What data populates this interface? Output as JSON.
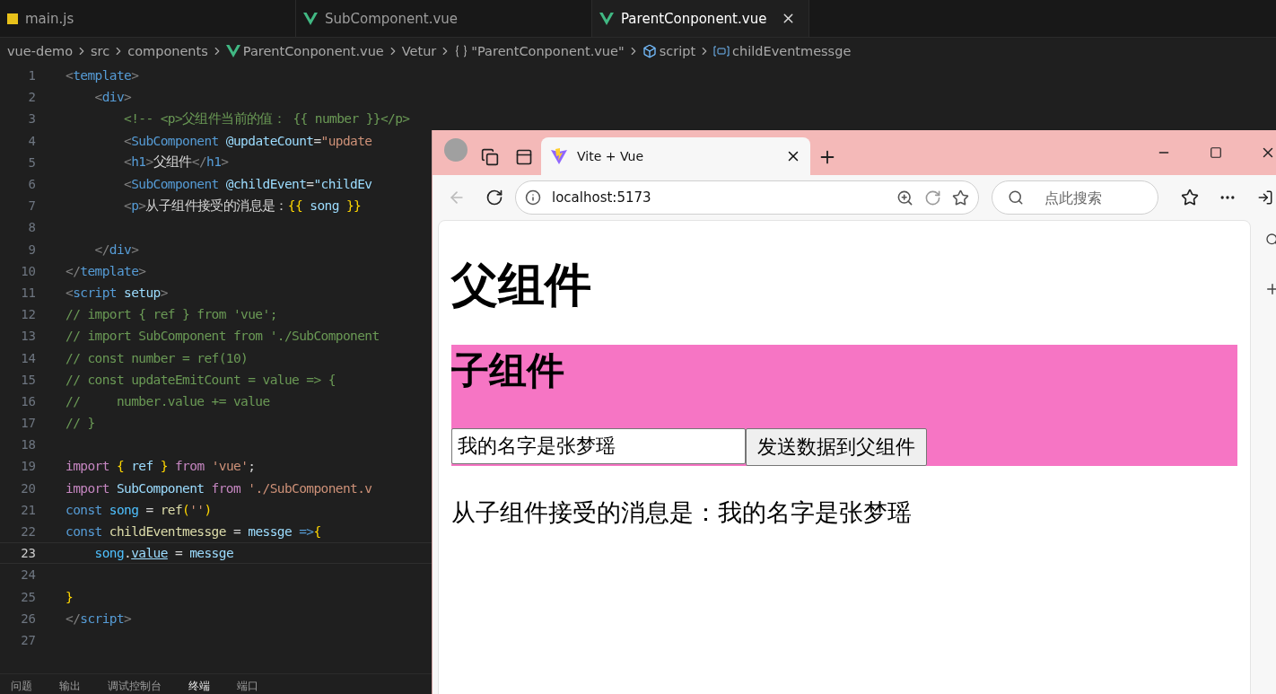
{
  "editor": {
    "tabs": [
      {
        "label": "main.js",
        "kind": "js",
        "selected": false
      },
      {
        "label": "SubComponent.vue",
        "kind": "vue",
        "selected": false
      },
      {
        "label": "ParentConponent.vue",
        "kind": "vue",
        "selected": true
      }
    ],
    "breadcrumbs": [
      {
        "label": "vue-demo",
        "kind": "text"
      },
      {
        "label": "src",
        "kind": "text"
      },
      {
        "label": "components",
        "kind": "text"
      },
      {
        "label": "ParentConponent.vue",
        "kind": "vue"
      },
      {
        "label": "Vetur",
        "kind": "text"
      },
      {
        "label": "\"ParentConponent.vue\"",
        "kind": "object"
      },
      {
        "label": "script",
        "kind": "cube"
      },
      {
        "label": "childEventmessge",
        "kind": "variable"
      }
    ],
    "lines": [
      {
        "number": "1",
        "current": false,
        "tokens": [
          {
            "text": "<",
            "kind": "punct"
          },
          {
            "text": "template",
            "kind": "tag"
          },
          {
            "text": ">",
            "kind": "punct"
          }
        ]
      },
      {
        "number": "2",
        "current": false,
        "tokens": [
          {
            "text": "    <",
            "kind": "punct"
          },
          {
            "text": "div",
            "kind": "tag"
          },
          {
            "text": ">",
            "kind": "punct"
          }
        ]
      },
      {
        "number": "3",
        "current": false,
        "tokens": [
          {
            "text": "        <!-- <p>父组件当前的值： {{ number }}</p>",
            "kind": "comment"
          }
        ]
      },
      {
        "number": "4",
        "current": false,
        "tokens": [
          {
            "text": "        <",
            "kind": "punct"
          },
          {
            "text": "SubComponent",
            "kind": "tag"
          },
          {
            "text": " @updateCount",
            "kind": "attr"
          },
          {
            "text": "=",
            "kind": "text"
          },
          {
            "text": "\"update",
            "kind": "string"
          }
        ]
      },
      {
        "number": "5",
        "current": false,
        "tokens": [
          {
            "text": "        <",
            "kind": "punct"
          },
          {
            "text": "h1",
            "kind": "tag"
          },
          {
            "text": ">",
            "kind": "punct"
          },
          {
            "text": "父组件",
            "kind": "text"
          },
          {
            "text": "</",
            "kind": "punct"
          },
          {
            "text": "h1",
            "kind": "tag"
          },
          {
            "text": ">",
            "kind": "punct"
          }
        ]
      },
      {
        "number": "6",
        "current": false,
        "tokens": [
          {
            "text": "        <",
            "kind": "punct"
          },
          {
            "text": "SubComponent",
            "kind": "tag"
          },
          {
            "text": " @childEvent",
            "kind": "attr"
          },
          {
            "text": "=",
            "kind": "text"
          },
          {
            "text": "\"childEv",
            "kind": "attr"
          }
        ]
      },
      {
        "number": "7",
        "current": false,
        "tokens": [
          {
            "text": "        <",
            "kind": "punct"
          },
          {
            "text": "p",
            "kind": "tag"
          },
          {
            "text": ">",
            "kind": "punct"
          },
          {
            "text": "从子组件接受的消息是：",
            "kind": "text"
          },
          {
            "text": "{{",
            "kind": "brace"
          },
          {
            "text": " song ",
            "kind": "attr"
          },
          {
            "text": "}}",
            "kind": "brace"
          }
        ]
      },
      {
        "number": "8",
        "current": false
      },
      {
        "number": "9",
        "current": false,
        "tokens": [
          {
            "text": "    </",
            "kind": "punct"
          },
          {
            "text": "div",
            "kind": "tag"
          },
          {
            "text": ">",
            "kind": "punct"
          }
        ]
      },
      {
        "number": "10",
        "current": false,
        "tokens": [
          {
            "text": "</",
            "kind": "punct"
          },
          {
            "text": "template",
            "kind": "tag"
          },
          {
            "text": ">",
            "kind": "punct"
          }
        ]
      },
      {
        "number": "11",
        "current": false,
        "tokens": [
          {
            "text": "<",
            "kind": "punct"
          },
          {
            "text": "script",
            "kind": "tag"
          },
          {
            "text": " setup",
            "kind": "attr"
          },
          {
            "text": ">",
            "kind": "punct"
          }
        ]
      },
      {
        "number": "12",
        "current": false,
        "tokens": [
          {
            "text": "// import { ref } from 'vue';",
            "kind": "comment"
          }
        ]
      },
      {
        "number": "13",
        "current": false,
        "tokens": [
          {
            "text": "// import SubComponent from './SubComponent",
            "kind": "comment"
          }
        ]
      },
      {
        "number": "14",
        "current": false,
        "tokens": [
          {
            "text": "// const number = ref(10)",
            "kind": "comment"
          }
        ]
      },
      {
        "number": "15",
        "current": false,
        "tokens": [
          {
            "text": "// const updateEmitCount = value => {",
            "kind": "comment"
          }
        ]
      },
      {
        "number": "16",
        "current": false,
        "tokens": [
          {
            "text": "//     number.value += value",
            "kind": "comment"
          }
        ]
      },
      {
        "number": "17",
        "current": false,
        "tokens": [
          {
            "text": "// }",
            "kind": "comment"
          }
        ]
      },
      {
        "number": "18",
        "current": false
      },
      {
        "number": "19",
        "current": false,
        "tokens": [
          {
            "text": "import ",
            "kind": "keyword"
          },
          {
            "text": "{",
            "kind": "brace"
          },
          {
            "text": " ref ",
            "kind": "attr"
          },
          {
            "text": "}",
            "kind": "brace"
          },
          {
            "text": " from",
            "kind": "keyword"
          },
          {
            "text": " 'vue'",
            "kind": "string"
          },
          {
            "text": ";",
            "kind": "text"
          }
        ]
      },
      {
        "number": "20",
        "current": false,
        "tokens": [
          {
            "text": "import",
            "kind": "keyword"
          },
          {
            "text": " SubComponent",
            "kind": "attr"
          },
          {
            "text": " from",
            "kind": "keyword"
          },
          {
            "text": " './SubComponent.v",
            "kind": "string"
          }
        ]
      },
      {
        "number": "21",
        "current": false,
        "tokens": [
          {
            "text": "const",
            "kind": "storage"
          },
          {
            "text": " song",
            "kind": "constant"
          },
          {
            "text": " = ",
            "kind": "text"
          },
          {
            "text": "ref",
            "kind": "function"
          },
          {
            "text": "(",
            "kind": "brace"
          },
          {
            "text": "''",
            "kind": "string"
          },
          {
            "text": ")",
            "kind": "brace"
          }
        ]
      },
      {
        "number": "22",
        "current": false,
        "tokens": [
          {
            "text": "const",
            "kind": "storage"
          },
          {
            "text": " childEventmessge",
            "kind": "function"
          },
          {
            "text": " = ",
            "kind": "text"
          },
          {
            "text": "messge",
            "kind": "attr"
          },
          {
            "text": " =>",
            "kind": "storage"
          },
          {
            "text": "{",
            "kind": "brace"
          }
        ]
      },
      {
        "number": "23",
        "current": true,
        "tokens": [
          {
            "text": "    song",
            "kind": "constant"
          },
          {
            "text": ".",
            "kind": "text"
          },
          {
            "text": "value",
            "kind": "underlined"
          },
          {
            "text": " = ",
            "kind": "text"
          },
          {
            "text": "messge",
            "kind": "attr"
          }
        ]
      },
      {
        "number": "24",
        "current": false
      },
      {
        "number": "25",
        "current": false,
        "tokens": [
          {
            "text": "}",
            "kind": "brace"
          }
        ]
      },
      {
        "number": "26",
        "current": false,
        "tokens": [
          {
            "text": "</",
            "kind": "punct"
          },
          {
            "text": "script",
            "kind": "tag"
          },
          {
            "text": ">",
            "kind": "punct"
          }
        ]
      },
      {
        "number": "27",
        "current": false
      }
    ],
    "panel_tabs": [
      {
        "label": "问题",
        "selected": false
      },
      {
        "label": "输出",
        "selected": false
      },
      {
        "label": "调试控制台",
        "selected": false
      },
      {
        "label": "终端",
        "selected": true
      },
      {
        "label": "端口",
        "selected": false
      }
    ]
  },
  "browser": {
    "tab": {
      "title": "Vite + Vue"
    },
    "address": "localhost:5173",
    "search": {
      "placeholder": "点此搜索"
    },
    "page": {
      "heading": "父组件",
      "child": {
        "heading": "子组件",
        "input_value": "我的名字是张梦瑶",
        "button": "发送数据到父组件"
      },
      "message": "从子组件接受的消息是：我的名字是张梦瑶"
    }
  }
}
